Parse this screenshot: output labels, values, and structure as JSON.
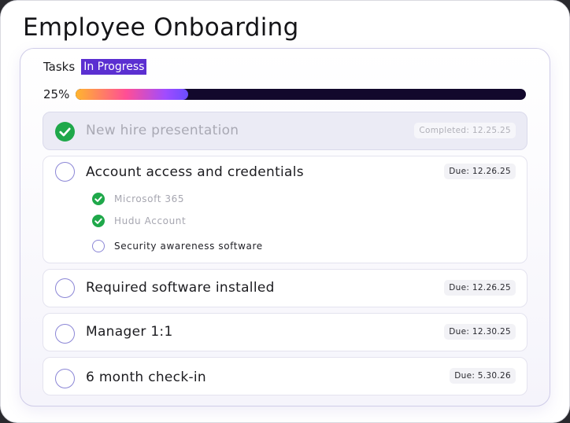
{
  "page": {
    "title": "Employee Onboarding"
  },
  "tasks_panel": {
    "label": "Tasks",
    "status": "In Progress",
    "progress_text": "25%",
    "progress_fraction": 0.25
  },
  "tasks": [
    {
      "title": "New hire presentation",
      "date_label": "Completed: 12.25.25",
      "completed": true
    },
    {
      "title": "Account access and credentials",
      "date_label": "Due: 12.26.25",
      "completed": false,
      "subtasks": [
        {
          "label": "Microsoft 365",
          "completed": true
        },
        {
          "label": "Hudu Account",
          "completed": true
        },
        {
          "label": "Security awareness software",
          "completed": false
        }
      ]
    },
    {
      "title": "Required software installed",
      "date_label": "Due: 12.26.25",
      "completed": false
    },
    {
      "title": "Manager 1:1",
      "date_label": "Due: 12.30.25",
      "completed": false
    },
    {
      "title": "6 month check-in",
      "date_label": "Due: 5.30.26",
      "completed": false
    }
  ],
  "icons": {
    "completed": "check-circle-icon",
    "pending": "empty-circle-icon"
  },
  "colors": {
    "accent": "#5b2fd1",
    "success": "#1fa84a",
    "progress_track": "#12082c"
  }
}
